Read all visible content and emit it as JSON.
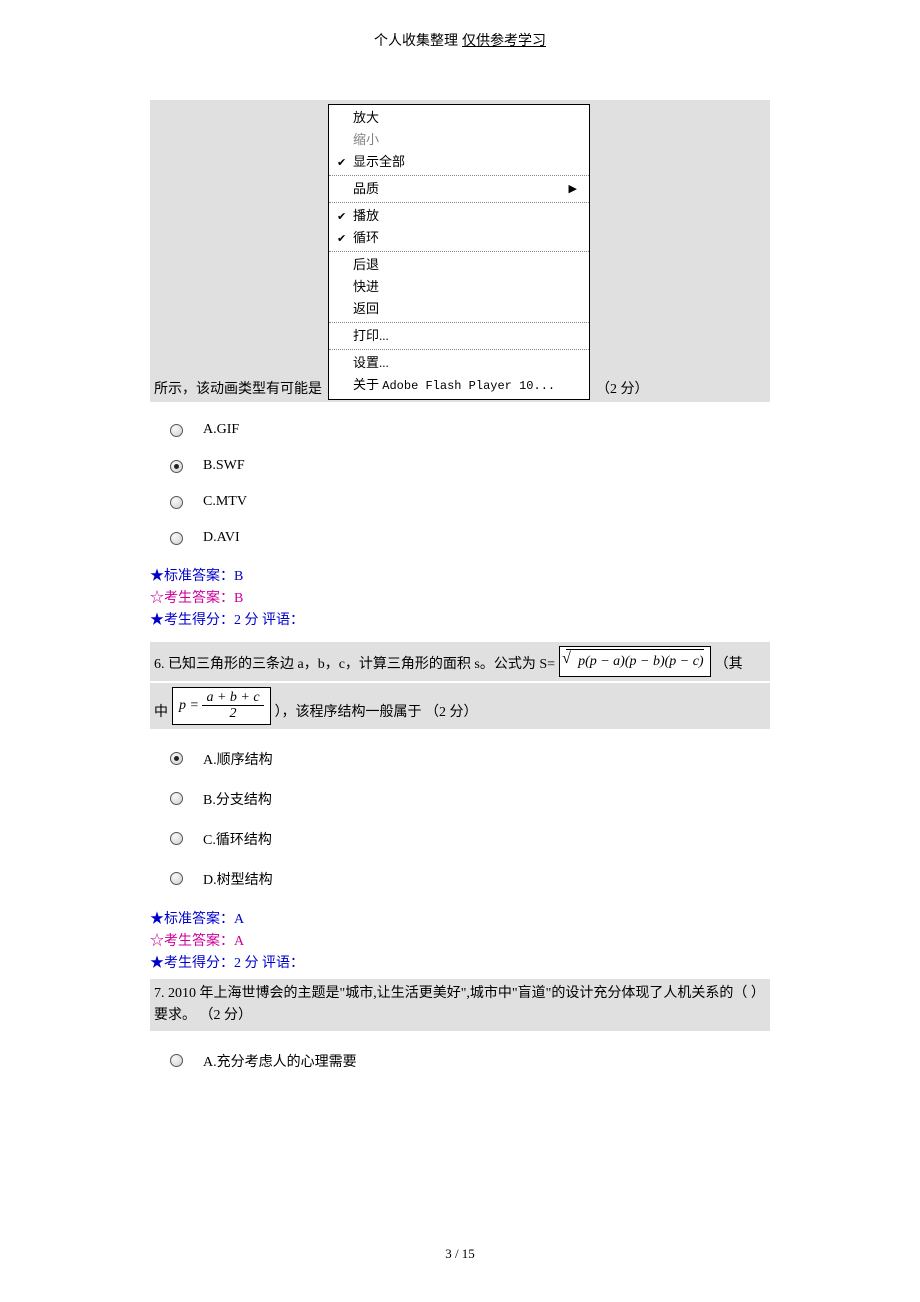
{
  "header": {
    "text1": "个人收集整理",
    "text2": "仅供参考学习"
  },
  "menu": {
    "s1": {
      "zoom_in": "放大",
      "zoom_out": "缩小",
      "show_all": "显示全部"
    },
    "s2": {
      "quality": "品质"
    },
    "s3": {
      "play": "播放",
      "loop": "循环"
    },
    "s4": {
      "back": "后退",
      "forward": "快进",
      "return": "返回"
    },
    "s5": {
      "print": "打印..."
    },
    "s6": {
      "settings": "设置...",
      "about_prefix": "关于 ",
      "about_mono": "Adobe Flash Player 10..."
    }
  },
  "q5": {
    "prefix": "所示，该动画类型有可能是",
    "points": "（2 分）",
    "options": {
      "a": "A.GIF",
      "b": "B.SWF",
      "c": "C.MTV",
      "d": "D.AVI"
    },
    "answer": {
      "std": "★标准答案：B",
      "stu": "☆考生答案：B",
      "score": "★考生得分：2 分  评语："
    }
  },
  "q6": {
    "part1": "6. 已知三角形的三条边 a，b，c，计算三角形的面积 s。公式为 S=",
    "formula1_paren1": "p",
    "formula1_paren2": "(p − a)(p − b)(p − c)",
    "part1_end": "（其",
    "part2_start": "中",
    "formula2_lhs": "p =",
    "formula2_num": "a + b + c",
    "formula2_den": "2",
    "part2_end": "），该程序结构一般属于 （2 分）",
    "options": {
      "a": "A.顺序结构",
      "b": "B.分支结构",
      "c": "C.循环结构",
      "d": "D.树型结构"
    },
    "answer": {
      "std": "★标准答案：A",
      "stu": "☆考生答案：A",
      "score": "★考生得分：2 分  评语："
    }
  },
  "q7": {
    "text": "7. 2010 年上海世博会的主题是\"城市,让生活更美好\",城市中\"盲道\"的设计充分体现了人机关系的（  ）要求。 （2 分）",
    "options": {
      "a": "A.充分考虑人的心理需要"
    }
  },
  "footer": "3  / 15"
}
